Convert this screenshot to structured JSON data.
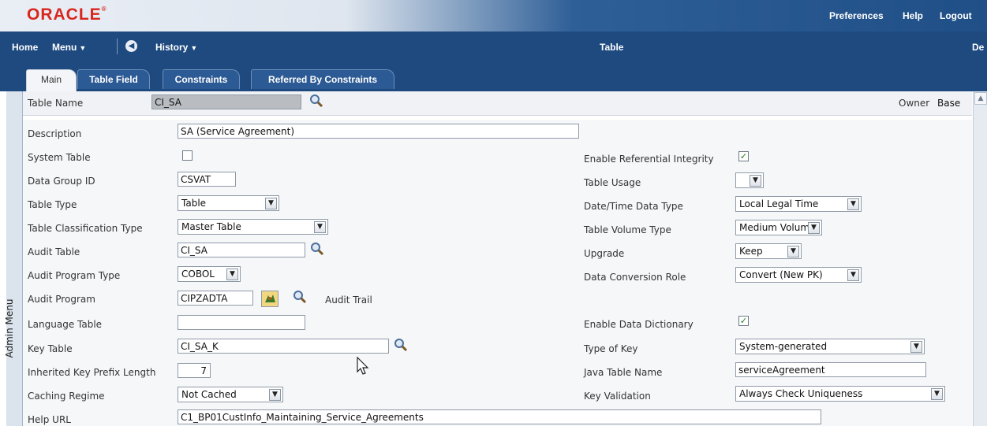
{
  "brand": {
    "logo_text": "ORACLE"
  },
  "top_links": {
    "preferences": "Preferences",
    "help": "Help",
    "logout": "Logout"
  },
  "nav": {
    "home": "Home",
    "menu": "Menu",
    "history": "History",
    "page_title": "Table",
    "right_cut": "De"
  },
  "tabs": [
    {
      "label": "Main",
      "active": true
    },
    {
      "label": "Table Field",
      "active": false
    },
    {
      "label": "Constraints",
      "active": false
    },
    {
      "label": "Referred By Constraints",
      "active": false
    }
  ],
  "side": {
    "admin_menu": "Admin Menu"
  },
  "header": {
    "table_name_label": "Table Name",
    "table_name_value": "CI_SA",
    "owner_label": "Owner",
    "owner_value": "Base"
  },
  "left_fields": {
    "description": {
      "label": "Description",
      "value": "SA (Service Agreement)"
    },
    "system_table": {
      "label": "System Table",
      "checked": false
    },
    "data_group_id": {
      "label": "Data Group ID",
      "value": "CSVAT"
    },
    "table_type": {
      "label": "Table Type",
      "value": "Table"
    },
    "table_classification_type": {
      "label": "Table Classification Type",
      "value": "Master Table"
    },
    "audit_table": {
      "label": "Audit Table",
      "value": "CI_SA"
    },
    "audit_program_type": {
      "label": "Audit Program Type",
      "value": "COBOL"
    },
    "audit_program": {
      "label": "Audit Program",
      "value": "CIPZADTA",
      "extra": "Audit Trail"
    },
    "language_table": {
      "label": "Language Table",
      "value": ""
    },
    "key_table": {
      "label": "Key Table",
      "value": "CI_SA_K"
    },
    "inherited_key_prefix_length": {
      "label": "Inherited Key Prefix Length",
      "value": "7"
    },
    "caching_regime": {
      "label": "Caching Regime",
      "value": "Not Cached"
    },
    "help_url": {
      "label": "Help URL",
      "value": "C1_BP01CustInfo_Maintaining_Service_Agreements"
    }
  },
  "right_fields": {
    "enable_referential_integrity": {
      "label": "Enable Referential Integrity",
      "checked": true
    },
    "table_usage": {
      "label": "Table Usage",
      "value": ""
    },
    "date_time_data_type": {
      "label": "Date/Time Data Type",
      "value": "Local Legal Time"
    },
    "table_volume_type": {
      "label": "Table Volume Type",
      "value": "Medium Volume"
    },
    "upgrade": {
      "label": "Upgrade",
      "value": "Keep"
    },
    "data_conversion_role": {
      "label": "Data Conversion Role",
      "value": "Convert (New PK)"
    },
    "enable_data_dictionary": {
      "label": "Enable Data Dictionary",
      "checked": true
    },
    "type_of_key": {
      "label": "Type of Key",
      "value": "System-generated"
    },
    "java_table_name": {
      "label": "Java Table Name",
      "value": "serviceAgreement"
    },
    "key_validation": {
      "label": "Key Validation",
      "value": "Always Check Uniqueness"
    }
  },
  "colors": {
    "brand_red": "#d8261c",
    "nav_blue": "#1e4a80",
    "check_green": "#1a7a1a"
  }
}
